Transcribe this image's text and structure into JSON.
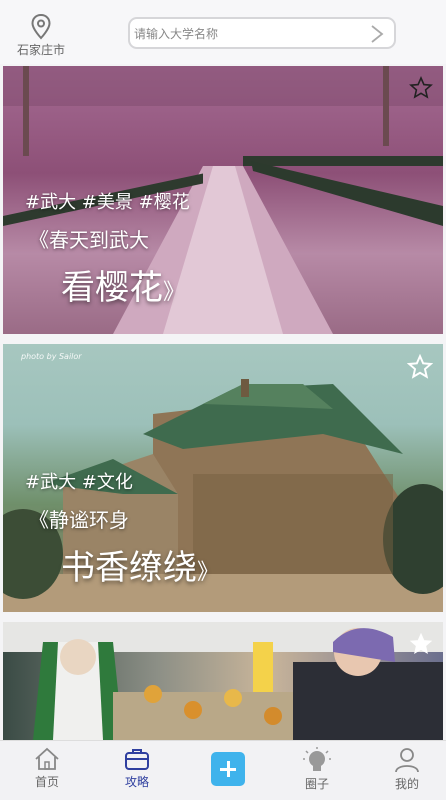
{
  "header": {
    "city": "石家庄市",
    "search_placeholder": "请输入大学名称"
  },
  "cards": [
    {
      "tags": "#武大 #美景 #樱花",
      "title_line1": "《春天到武大",
      "title_line2": "看樱花",
      "title_close": "》"
    },
    {
      "tags": "#武大 #文化",
      "title_line1": "《静谧环身",
      "title_line2": "书香缭绕",
      "title_close": "》",
      "watermark": "photo by Sailor"
    },
    {
      "tags": "",
      "title_line1": "",
      "title_line2": "",
      "title_close": ""
    }
  ],
  "tabbar": {
    "items": [
      {
        "label": "首页",
        "icon": "home-icon"
      },
      {
        "label": "攻略",
        "icon": "briefcase-icon",
        "active": true
      },
      {
        "label": "",
        "icon": "plus-icon"
      },
      {
        "label": "圈子",
        "icon": "lightbulb-icon"
      },
      {
        "label": "我的",
        "icon": "user-icon"
      }
    ]
  },
  "colors": {
    "accent": "#3fb3ec",
    "active_tab": "#2f3f9f"
  }
}
